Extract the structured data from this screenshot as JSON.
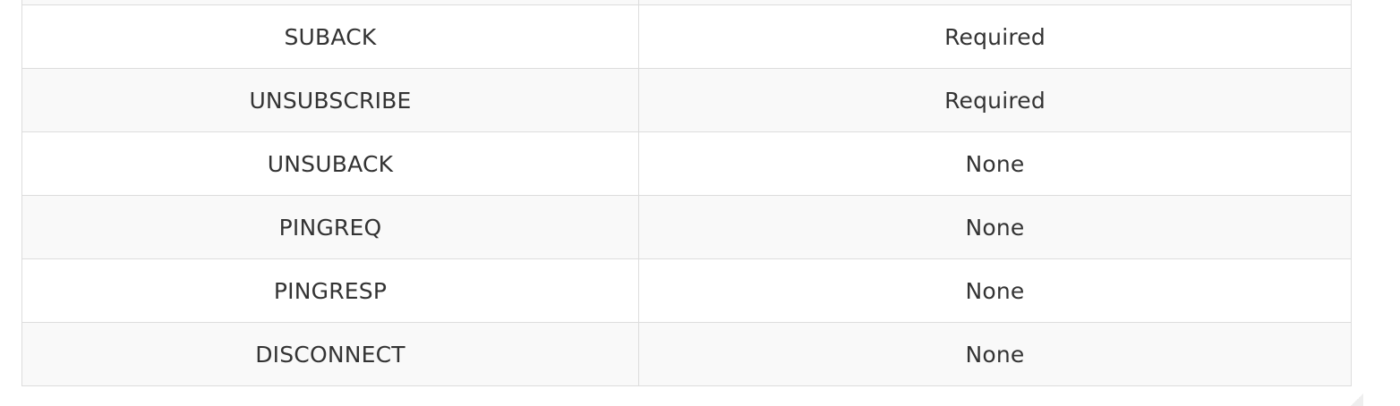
{
  "table": {
    "rows": [
      {
        "packet": "",
        "payload": ""
      },
      {
        "packet": "SUBACK",
        "payload": "Required"
      },
      {
        "packet": "UNSUBSCRIBE",
        "payload": "Required"
      },
      {
        "packet": "UNSUBACK",
        "payload": "None"
      },
      {
        "packet": "PINGREQ",
        "payload": "None"
      },
      {
        "packet": "PINGRESP",
        "payload": "None"
      },
      {
        "packet": "DISCONNECT",
        "payload": "None"
      }
    ]
  }
}
